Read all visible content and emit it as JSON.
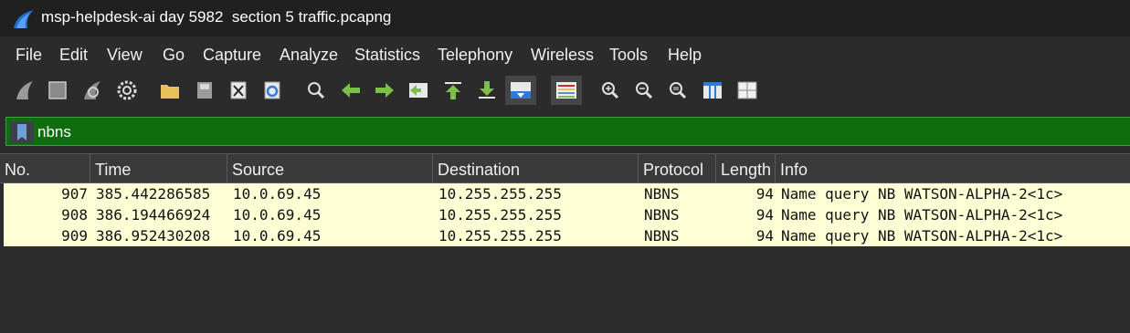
{
  "window": {
    "title": "msp-helpdesk-ai day 5982  section 5 traffic.pcapng"
  },
  "menu": {
    "items": [
      "File",
      "Edit",
      "View",
      "Go",
      "Capture",
      "Analyze",
      "Statistics",
      "Telephony",
      "Wireless",
      "Tools",
      "Help"
    ]
  },
  "toolbar": {
    "buttons": [
      "shark-fin-start-icon",
      "stop-square-icon",
      "restart-capture-icon",
      "capture-options-gear-icon",
      "open-folder-icon",
      "save-file-icon",
      "close-file-icon",
      "reload-file-icon",
      "find-packet-icon",
      "go-back-arrow-icon",
      "go-forward-arrow-icon",
      "go-to-packet-icon",
      "go-first-packet-icon",
      "go-last-packet-icon",
      "autoscroll-icon",
      "colorize-icon",
      "zoom-in-icon",
      "zoom-out-icon",
      "normal-size-icon",
      "resize-columns-icon",
      "columns-icon"
    ]
  },
  "filter": {
    "value": "nbns",
    "color": "#0e6e0e"
  },
  "packet_list": {
    "columns": [
      "No.",
      "Time",
      "Source",
      "Destination",
      "Protocol",
      "Length",
      "Info"
    ],
    "rows": [
      {
        "no": "907",
        "time": "385.442286585",
        "source": "10.0.69.45",
        "destination": "10.255.255.255",
        "protocol": "NBNS",
        "length": "94",
        "info": "Name query NB WATSON-ALPHA-2<1c>"
      },
      {
        "no": "908",
        "time": "386.194466924",
        "source": "10.0.69.45",
        "destination": "10.255.255.255",
        "protocol": "NBNS",
        "length": "94",
        "info": "Name query NB WATSON-ALPHA-2<1c>"
      },
      {
        "no": "909",
        "time": "386.952430208",
        "source": "10.0.69.45",
        "destination": "10.255.255.255",
        "protocol": "NBNS",
        "length": "94",
        "info": "Name query NB WATSON-ALPHA-2<1c>"
      }
    ],
    "row_color": "#ffffd6"
  }
}
